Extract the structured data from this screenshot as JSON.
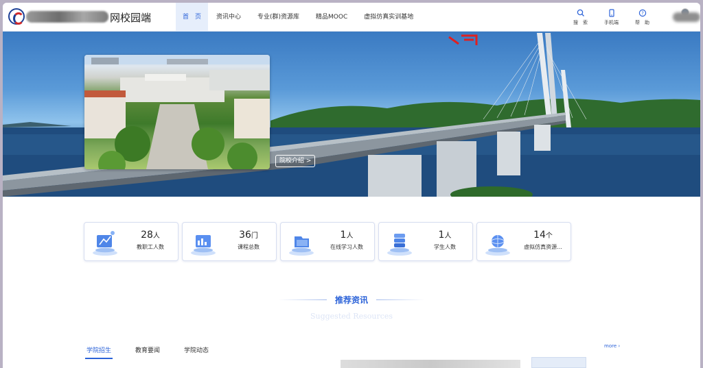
{
  "header": {
    "site_title": "网校园端",
    "nav": [
      {
        "label": "首　页",
        "active": true
      },
      {
        "label": "资讯中心"
      },
      {
        "label": "专业(群)资源库"
      },
      {
        "label": "精品MOOC"
      },
      {
        "label": "虚拟仿真实训基地"
      }
    ],
    "tools": [
      {
        "label": "搜　索",
        "icon": "search-icon"
      },
      {
        "label": "手机端",
        "icon": "mobile-icon"
      },
      {
        "label": "帮　助",
        "icon": "help-icon"
      }
    ]
  },
  "banner": {
    "intro_button": "院校介绍 >"
  },
  "stats": [
    {
      "value": "28",
      "unit": "人",
      "caption": "教职工人数",
      "icon": "staff-icon"
    },
    {
      "value": "36",
      "unit": "门",
      "caption": "课程总数",
      "icon": "course-icon"
    },
    {
      "value": "1",
      "unit": "人",
      "caption": "在线学习人数",
      "icon": "online-learning-icon"
    },
    {
      "value": "1",
      "unit": "人",
      "caption": "学生人数",
      "icon": "student-icon"
    },
    {
      "value": "14",
      "unit": "个",
      "caption": "虚拟仿真资源...",
      "icon": "simulation-icon"
    }
  ],
  "section": {
    "title": "推荐资讯",
    "subtitle": "Suggested Resources"
  },
  "news_tabs": [
    {
      "label": "学院招生",
      "active": true
    },
    {
      "label": "教育要闻"
    },
    {
      "label": "学院动态"
    }
  ],
  "more_label": "more ›",
  "colors": {
    "accent": "#2b62d8",
    "nav_active_bg": "#e6eefb"
  }
}
